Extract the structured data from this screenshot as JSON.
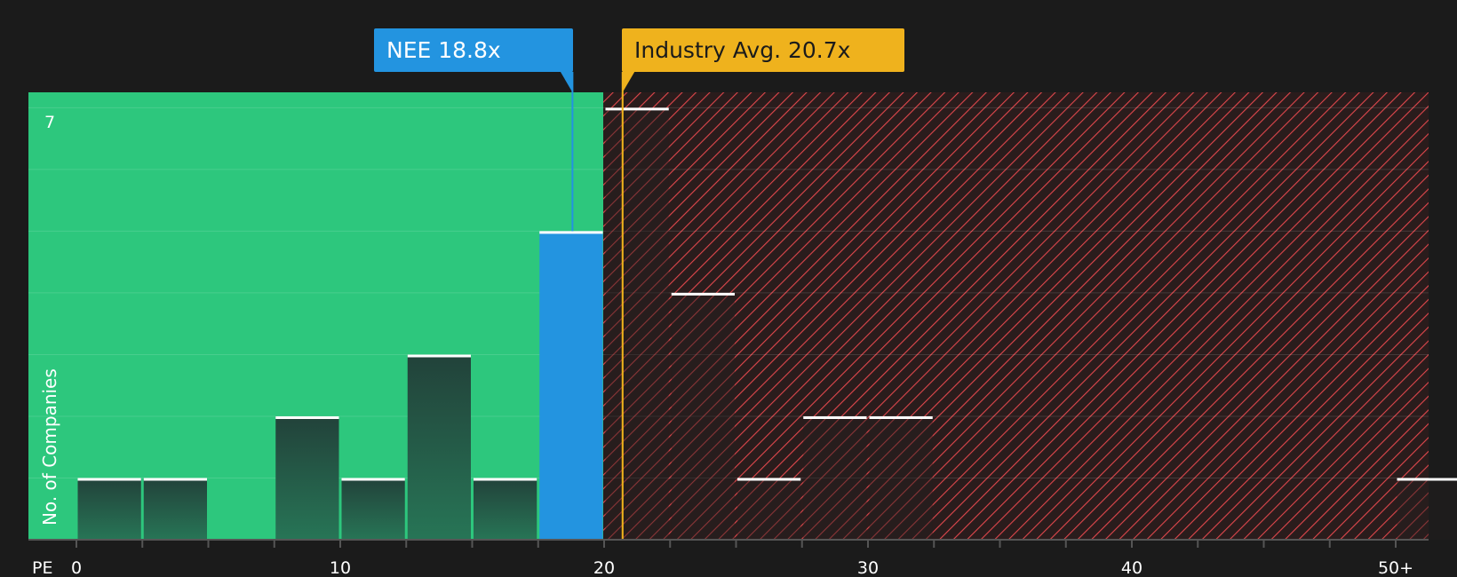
{
  "chart_data": {
    "type": "bar",
    "x_axis_label": "PE",
    "y_axis_label": "No. of Companies",
    "y_tick_label": "7",
    "ylim": [
      0,
      7.25
    ],
    "x_ticks": [
      {
        "value": 0,
        "label": "0"
      },
      {
        "value": 10,
        "label": "10"
      },
      {
        "value": 20,
        "label": "20"
      },
      {
        "value": 30,
        "label": "30"
      },
      {
        "value": 40,
        "label": "40"
      },
      {
        "value": 50,
        "label": "50+"
      }
    ],
    "bins": [
      {
        "start": 0,
        "end": 2.5,
        "count": 1
      },
      {
        "start": 2.5,
        "end": 5,
        "count": 1
      },
      {
        "start": 5,
        "end": 7.5,
        "count": 0
      },
      {
        "start": 7.5,
        "end": 10,
        "count": 2
      },
      {
        "start": 10,
        "end": 12.5,
        "count": 1
      },
      {
        "start": 12.5,
        "end": 15,
        "count": 3
      },
      {
        "start": 15,
        "end": 17.5,
        "count": 1
      },
      {
        "start": 17.5,
        "end": 20,
        "count": 5,
        "highlight": true
      },
      {
        "start": 20,
        "end": 22.5,
        "count": 7
      },
      {
        "start": 22.5,
        "end": 25,
        "count": 4
      },
      {
        "start": 25,
        "end": 27.5,
        "count": 1
      },
      {
        "start": 27.5,
        "end": 30,
        "count": 2
      },
      {
        "start": 30,
        "end": 32.5,
        "count": 2
      },
      {
        "start": 50,
        "end": 52.5,
        "count": 1
      }
    ],
    "company": {
      "name": "NEE",
      "pe": 18.8,
      "label": "NEE 18.8x"
    },
    "industry_avg": {
      "pe": 20.7,
      "label": "Industry Avg. 20.7x"
    },
    "colors": {
      "background": "#1b1b1b",
      "undervalued_zone": "#2dc77d",
      "overvalued_hatch": "#e0474c",
      "company": "#2394e0",
      "industry": "#efb21d"
    },
    "grid": true
  }
}
